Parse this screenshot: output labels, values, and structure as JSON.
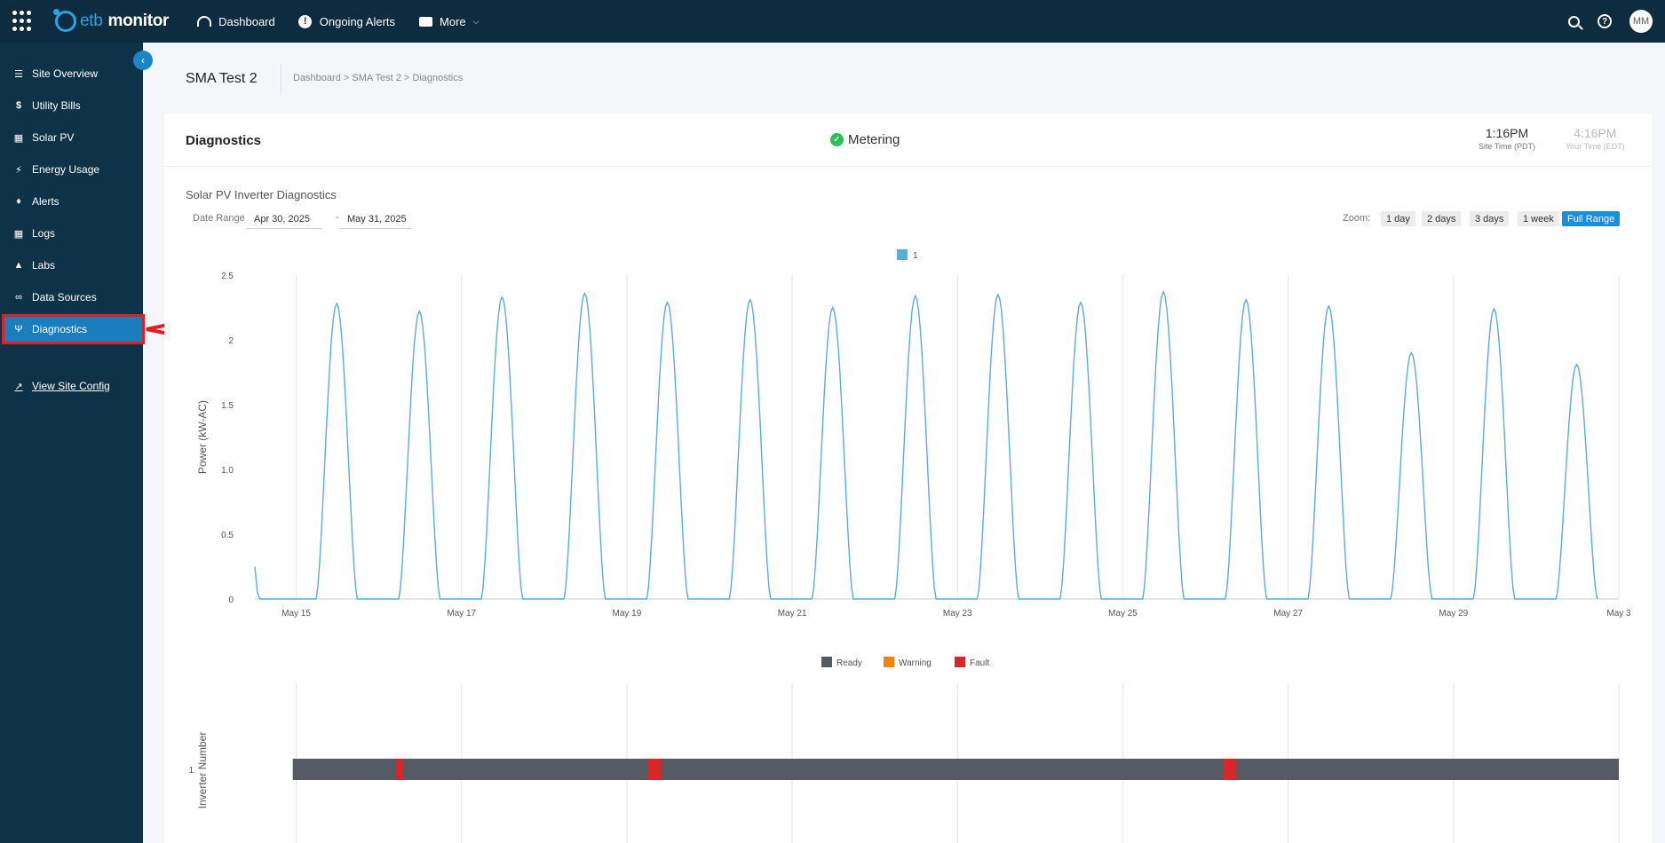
{
  "topbar": {
    "logo_prefix": "etb",
    "logo_name": "monitor",
    "nav": [
      {
        "label": "Dashboard",
        "icon": "dashboard-icon"
      },
      {
        "label": "Ongoing Alerts",
        "icon": "alert-icon"
      },
      {
        "label": "More",
        "icon": "folder-icon"
      }
    ],
    "avatar_initials": "MM"
  },
  "sidebar": {
    "items": [
      {
        "label": "Site Overview",
        "icon": "layers-icon"
      },
      {
        "label": "Utility Bills",
        "icon": "dollar-icon"
      },
      {
        "label": "Solar PV",
        "icon": "solar-panel-icon"
      },
      {
        "label": "Energy Usage",
        "icon": "bolt-icon"
      },
      {
        "label": "Alerts",
        "icon": "bell-icon"
      },
      {
        "label": "Logs",
        "icon": "table-icon"
      },
      {
        "label": "Labs",
        "icon": "flask-icon"
      },
      {
        "label": "Data Sources",
        "icon": "plug-icon"
      },
      {
        "label": "Diagnostics",
        "icon": "stethoscope-icon",
        "active": true
      }
    ],
    "config_link": "View Site Config"
  },
  "page": {
    "title": "SMA Test 2",
    "breadcrumb": [
      "Dashboard",
      "SMA Test 2",
      "Diagnostics"
    ],
    "breadcrumb_sep": ">"
  },
  "card": {
    "title": "Diagnostics",
    "status": "Metering",
    "status_color": "#2ebd59",
    "site_time": "1:16PM",
    "site_time_label": "Site Time (PDT)",
    "your_time": "4:16PM",
    "your_time_label": "Your Time (EDT)"
  },
  "diagnostics": {
    "section_title": "Solar PV Inverter Diagnostics",
    "date_range_label": "Date Range",
    "date_from": "Apr 30, 2025",
    "date_dash": "-",
    "date_to": "May 31, 2025",
    "zoom_label": "Zoom:",
    "zoom_options": [
      "1 day",
      "2 days",
      "3 days",
      "1 week",
      "Full Range"
    ],
    "zoom_selected": "Full Range"
  },
  "chart_data": [
    {
      "type": "line",
      "series": [
        {
          "name": "1",
          "color": "#5aaed4"
        }
      ],
      "ylabel": "Power (kW-AC)",
      "ylim": [
        0,
        2.5
      ],
      "yticks": [
        "0",
        "0.5",
        "1.0",
        "1.5",
        "2",
        "2.5"
      ],
      "xticks": [
        "May 15",
        "May 17",
        "May 19",
        "May 21",
        "May 23",
        "May 25",
        "May 27",
        "May 29",
        "May 3"
      ],
      "daily_peaks": [
        {
          "day": "May 15",
          "peak": 2.28
        },
        {
          "day": "May 16",
          "peak": 2.22
        },
        {
          "day": "May 17",
          "peak": 2.33
        },
        {
          "day": "May 18",
          "peak": 2.36
        },
        {
          "day": "May 19",
          "peak": 2.29
        },
        {
          "day": "May 20",
          "peak": 2.31
        },
        {
          "day": "May 21",
          "peak": 2.25
        },
        {
          "day": "May 22",
          "peak": 2.34
        },
        {
          "day": "May 23",
          "peak": 2.35
        },
        {
          "day": "May 24",
          "peak": 2.29
        },
        {
          "day": "May 25",
          "peak": 2.37
        },
        {
          "day": "May 26",
          "peak": 2.31
        },
        {
          "day": "May 27",
          "peak": 2.26
        },
        {
          "day": "May 28",
          "peak": 1.9
        },
        {
          "day": "May 29",
          "peak": 2.24
        },
        {
          "day": "May 30",
          "peak": 1.81
        }
      ]
    },
    {
      "type": "timeline",
      "ylabel": "Inverter Number",
      "yticks": [
        "1"
      ],
      "legend": [
        {
          "name": "Ready",
          "color": "#555a63"
        },
        {
          "name": "Warning",
          "color": "#f08214"
        },
        {
          "name": "Fault",
          "color": "#d62828"
        }
      ],
      "segments": [
        {
          "state": "Ready",
          "start": "May 14 23:00",
          "end": "May 31 00:00"
        },
        {
          "state": "Fault",
          "start": "May 16 05:00",
          "end": "May 16 07:00"
        },
        {
          "state": "Fault",
          "start": "May 19 06:00",
          "end": "May 19 10:00"
        },
        {
          "state": "Fault",
          "start": "May 26 05:00",
          "end": "May 26 09:00"
        }
      ]
    }
  ]
}
